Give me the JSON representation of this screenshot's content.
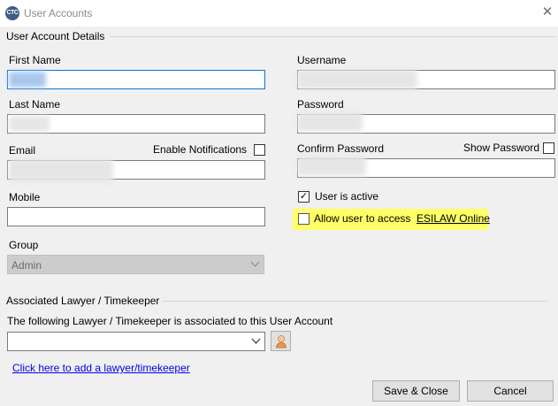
{
  "window": {
    "title": "User Accounts",
    "app_icon_text": "CTC",
    "close_glyph": "✕"
  },
  "details": {
    "group_title": "User Account Details",
    "first_name_label": "First Name",
    "last_name_label": "Last Name",
    "email_label": "Email",
    "enable_notifications_label": "Enable Notifications",
    "enable_notifications_checked": false,
    "mobile_label": "Mobile",
    "mobile_value": "",
    "group_label": "Group",
    "group_value": "Admin",
    "username_label": "Username",
    "password_label": "Password",
    "confirm_password_label": "Confirm Password",
    "show_password_label": "Show Password",
    "show_password_checked": false,
    "user_active_label": "User is active",
    "user_active_checked": true,
    "check_mark": "✓",
    "allow_access_label": "Allow user to access",
    "allow_access_link": "ESILAW Online",
    "allow_access_checked": false,
    "highlight_color": "#ffff66"
  },
  "lawyer": {
    "group_title": "Associated Lawyer / Timekeeper",
    "description": "The following Lawyer / Timekeeper is associated to this User Account",
    "select_value": "",
    "add_link": "Click here to add a lawyer/timekeeper"
  },
  "footer": {
    "save_label": "Save & Close",
    "cancel_label": "Cancel"
  },
  "icons": {
    "app": "app-logo-icon",
    "close": "close-icon",
    "dropdown": "chevron-down-icon",
    "person": "person-icon"
  }
}
